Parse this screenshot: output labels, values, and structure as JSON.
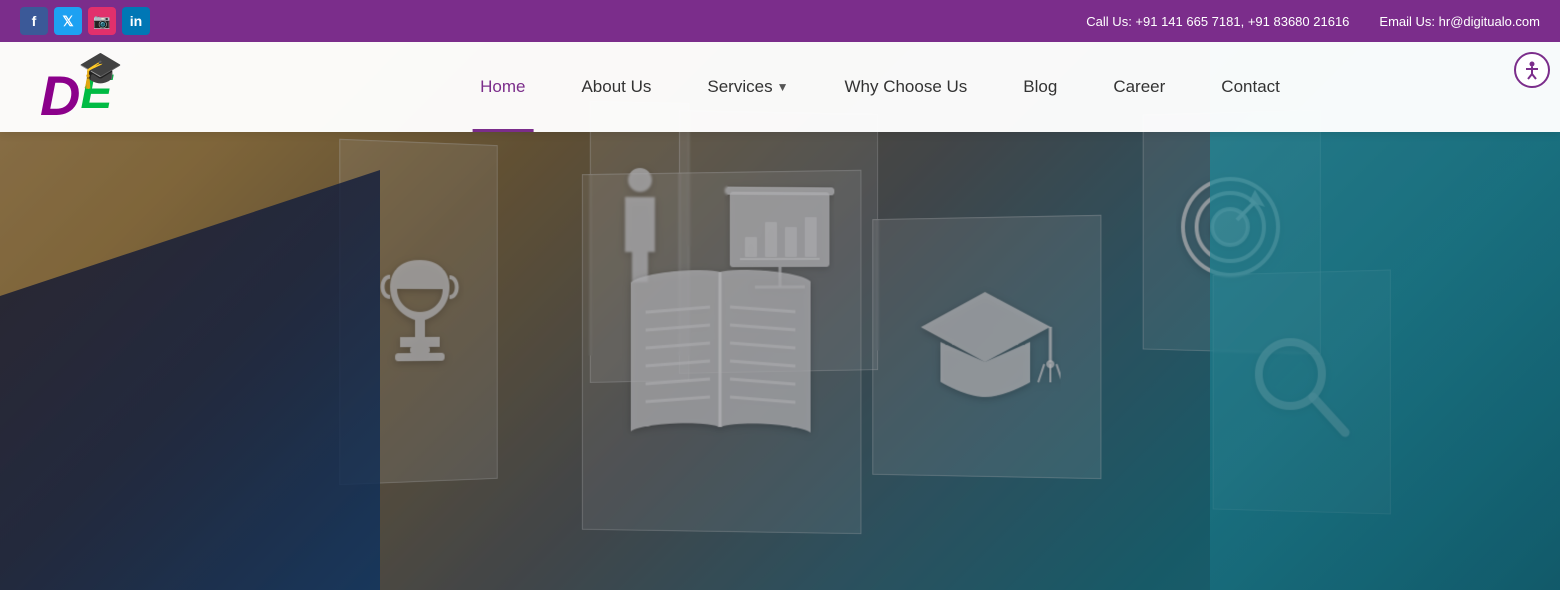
{
  "topbar": {
    "call_label": "Call Us: +91 141 665 7181, +91 83680 21616",
    "email_label": "Email Us: hr@digitualo.com",
    "social": [
      {
        "id": "facebook",
        "label": "f",
        "class": "social-fb"
      },
      {
        "id": "twitter",
        "label": "𝕏",
        "class": "social-tw"
      },
      {
        "id": "instagram",
        "label": "📷",
        "class": "social-ig"
      },
      {
        "id": "linkedin",
        "label": "in",
        "class": "social-li"
      }
    ]
  },
  "nav": {
    "items": [
      {
        "id": "home",
        "label": "Home",
        "active": true,
        "dropdown": false
      },
      {
        "id": "about",
        "label": "About Us",
        "active": false,
        "dropdown": false
      },
      {
        "id": "services",
        "label": "Services",
        "active": false,
        "dropdown": true
      },
      {
        "id": "why",
        "label": "Why Choose Us",
        "active": false,
        "dropdown": false
      },
      {
        "id": "blog",
        "label": "Blog",
        "active": false,
        "dropdown": false
      },
      {
        "id": "career",
        "label": "Career",
        "active": false,
        "dropdown": false
      },
      {
        "id": "contact",
        "label": "Contact",
        "active": false,
        "dropdown": false
      }
    ]
  },
  "logo": {
    "d": "D",
    "e": "E"
  },
  "accessibility": {
    "icon": "⎈"
  }
}
